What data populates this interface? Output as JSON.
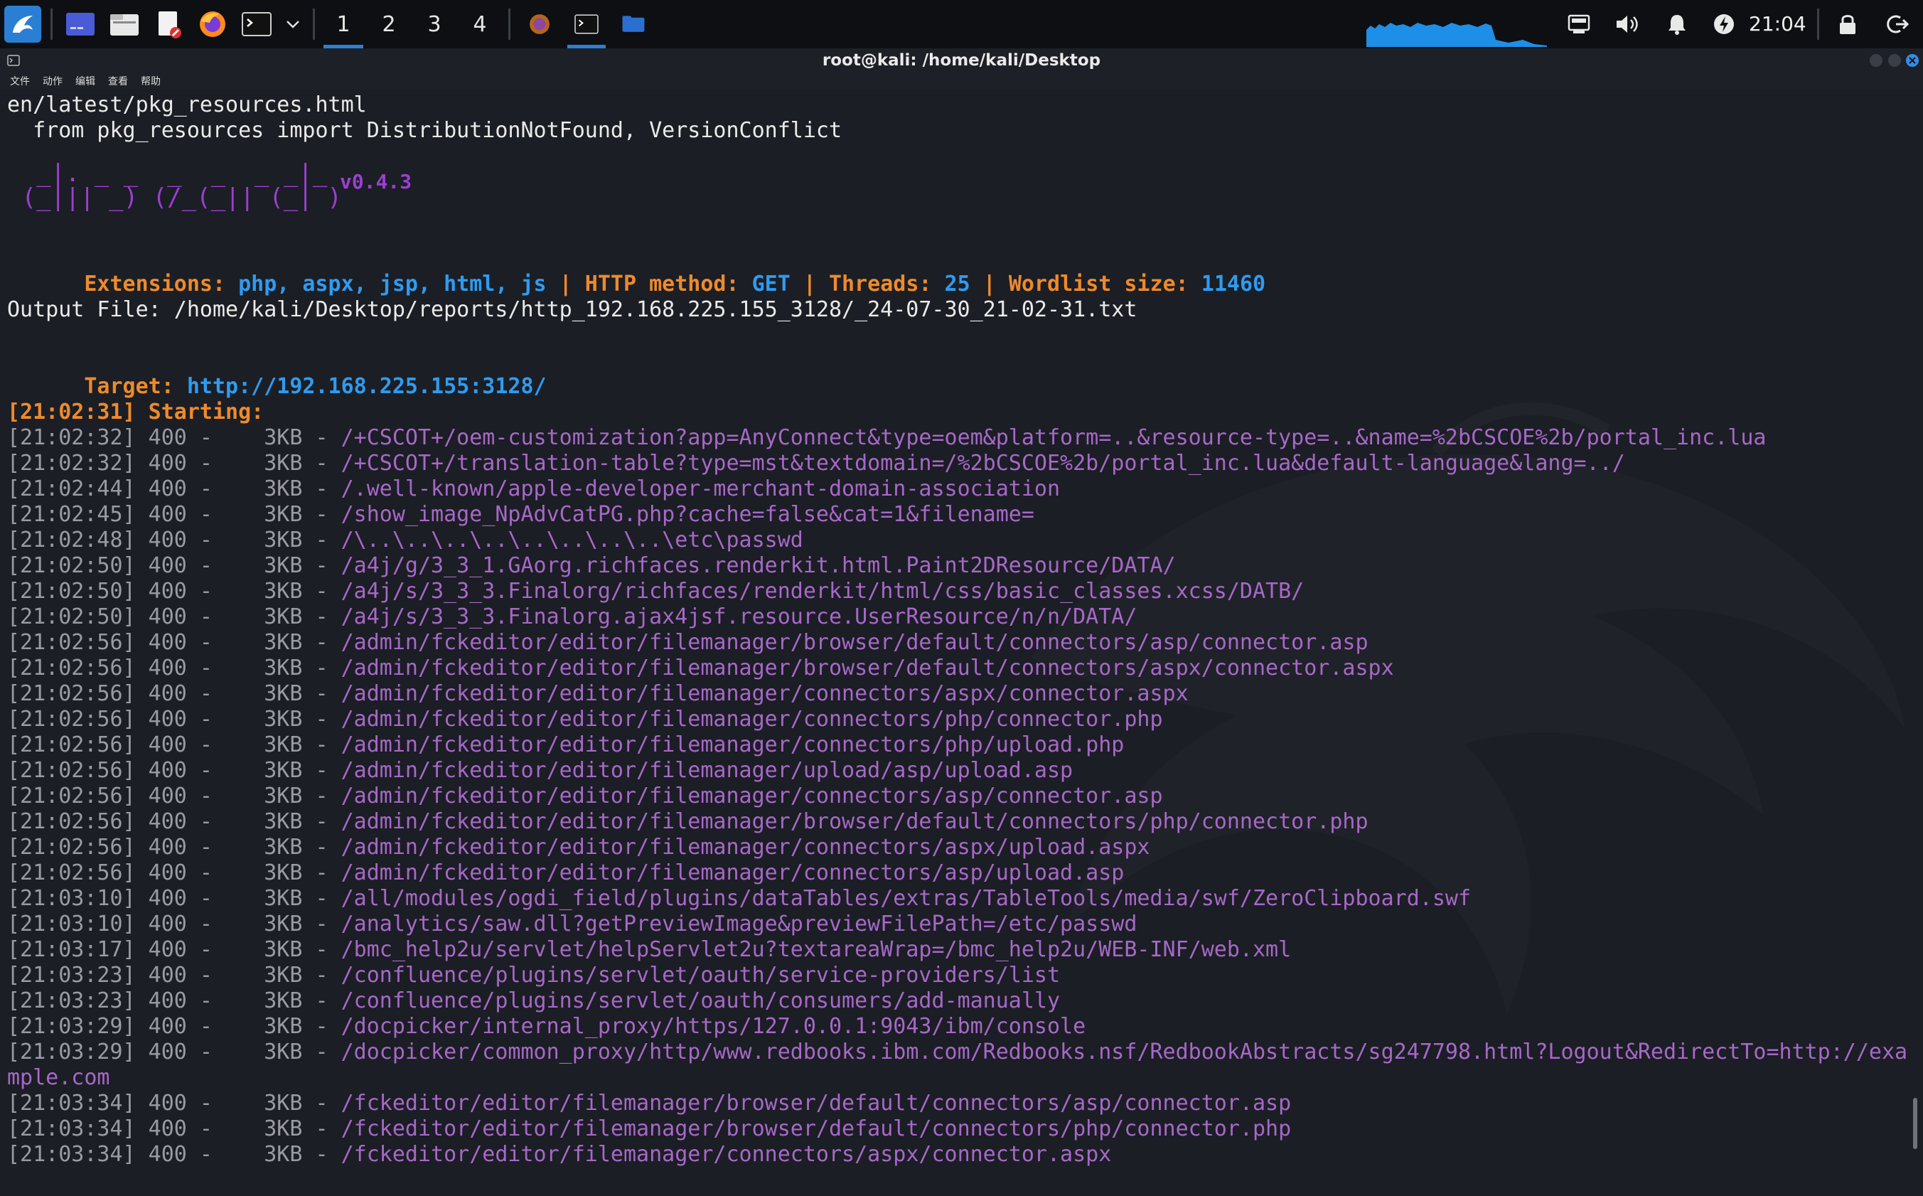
{
  "taskbar": {
    "workspaces": [
      "1",
      "2",
      "3",
      "4"
    ],
    "active_workspace": "1",
    "clock": "21:04",
    "icons": [
      "kali-menu-icon",
      "show-desktop-icon",
      "file-manager-icon",
      "text-editor-icon",
      "firefox-icon",
      "terminal-icon",
      "chevron-down-icon"
    ],
    "tray_icons": [
      "network-icon",
      "volume-icon",
      "notification-bell-icon",
      "power-manager-icon",
      "lock-icon",
      "logout-icon"
    ]
  },
  "window": {
    "title": "root@kali: /home/kali/Desktop",
    "menu": [
      "文件",
      "动作",
      "编辑",
      "查看",
      "帮助"
    ]
  },
  "terminal": {
    "pre_lines": [
      "en/latest/pkg_resources.html",
      "  from pkg_resources import DistributionNotFound, VersionConflict"
    ],
    "logo_line1": "  _|. _ _  _  _  _ _|_",
    "logo_line2": " (_||| _) (/_(_|| (_| )",
    "version": "v0.4.3",
    "config": {
      "ext_label": "Extensions:",
      "ext_value": "php, aspx, jsp, html, js",
      "method_label": "HTTP method:",
      "method_value": "GET",
      "threads_label": "Threads:",
      "threads_value": "25",
      "wordlist_label": "Wordlist size:",
      "wordlist_value": "11460",
      "sep": " | "
    },
    "output_file": "Output File: /home/kali/Desktop/reports/http_192.168.225.155_3128/_24-07-30_21-02-31.txt",
    "target_label": "Target:",
    "target_url": "http://192.168.225.155:3128/",
    "starting": "[21:02:31] Starting:",
    "results": [
      {
        "meta": "[21:02:32] 400 -    3KB - ",
        "path": "/+CSCOT+/oem-customization?app=AnyConnect&type=oem&platform=..&resource-type=..&name=%2bCSCOE%2b/portal_inc.lua"
      },
      {
        "meta": "[21:02:32] 400 -    3KB - ",
        "path": "/+CSCOT+/translation-table?type=mst&textdomain=/%2bCSCOE%2b/portal_inc.lua&default-language&lang=../"
      },
      {
        "meta": "[21:02:44] 400 -    3KB - ",
        "path": "/.well-known/apple-developer-merchant-domain-association"
      },
      {
        "meta": "[21:02:45] 400 -    3KB - ",
        "path": "/show_image_NpAdvCatPG.php?cache=false&cat=1&filename="
      },
      {
        "meta": "[21:02:48] 400 -    3KB - ",
        "path": "/\\..\\..\\..\\..\\..\\..\\..\\..\\etc\\passwd"
      },
      {
        "meta": "[21:02:50] 400 -    3KB - ",
        "path": "/a4j/g/3_3_1.GAorg.richfaces.renderkit.html.Paint2DResource/DATA/"
      },
      {
        "meta": "[21:02:50] 400 -    3KB - ",
        "path": "/a4j/s/3_3_3.Finalorg/richfaces/renderkit/html/css/basic_classes.xcss/DATB/"
      },
      {
        "meta": "[21:02:50] 400 -    3KB - ",
        "path": "/a4j/s/3_3_3.Finalorg.ajax4jsf.resource.UserResource/n/n/DATA/"
      },
      {
        "meta": "[21:02:56] 400 -    3KB - ",
        "path": "/admin/fckeditor/editor/filemanager/browser/default/connectors/asp/connector.asp"
      },
      {
        "meta": "[21:02:56] 400 -    3KB - ",
        "path": "/admin/fckeditor/editor/filemanager/browser/default/connectors/aspx/connector.aspx"
      },
      {
        "meta": "[21:02:56] 400 -    3KB - ",
        "path": "/admin/fckeditor/editor/filemanager/connectors/aspx/connector.aspx"
      },
      {
        "meta": "[21:02:56] 400 -    3KB - ",
        "path": "/admin/fckeditor/editor/filemanager/connectors/php/connector.php"
      },
      {
        "meta": "[21:02:56] 400 -    3KB - ",
        "path": "/admin/fckeditor/editor/filemanager/connectors/php/upload.php"
      },
      {
        "meta": "[21:02:56] 400 -    3KB - ",
        "path": "/admin/fckeditor/editor/filemanager/upload/asp/upload.asp"
      },
      {
        "meta": "[21:02:56] 400 -    3KB - ",
        "path": "/admin/fckeditor/editor/filemanager/connectors/asp/connector.asp"
      },
      {
        "meta": "[21:02:56] 400 -    3KB - ",
        "path": "/admin/fckeditor/editor/filemanager/browser/default/connectors/php/connector.php"
      },
      {
        "meta": "[21:02:56] 400 -    3KB - ",
        "path": "/admin/fckeditor/editor/filemanager/connectors/aspx/upload.aspx"
      },
      {
        "meta": "[21:02:56] 400 -    3KB - ",
        "path": "/admin/fckeditor/editor/filemanager/connectors/asp/upload.asp"
      },
      {
        "meta": "[21:03:10] 400 -    3KB - ",
        "path": "/all/modules/ogdi_field/plugins/dataTables/extras/TableTools/media/swf/ZeroClipboard.swf"
      },
      {
        "meta": "[21:03:10] 400 -    3KB - ",
        "path": "/analytics/saw.dll?getPreviewImage&previewFilePath=/etc/passwd"
      },
      {
        "meta": "[21:03:17] 400 -    3KB - ",
        "path": "/bmc_help2u/servlet/helpServlet2u?textareaWrap=/bmc_help2u/WEB-INF/web.xml"
      },
      {
        "meta": "[21:03:23] 400 -    3KB - ",
        "path": "/confluence/plugins/servlet/oauth/service-providers/list"
      },
      {
        "meta": "[21:03:23] 400 -    3KB - ",
        "path": "/confluence/plugins/servlet/oauth/consumers/add-manually"
      },
      {
        "meta": "[21:03:29] 400 -    3KB - ",
        "path": "/docpicker/internal_proxy/https/127.0.0.1:9043/ibm/console"
      },
      {
        "meta": "[21:03:29] 400 -    3KB - ",
        "path": "/docpicker/common_proxy/http/www.redbooks.ibm.com/Redbooks.nsf/RedbookAbstracts/sg247798.html?Logout&RedirectTo=http://exa"
      },
      {
        "meta": "",
        "path": "mple.com"
      },
      {
        "meta": "[21:03:34] 400 -    3KB - ",
        "path": "/fckeditor/editor/filemanager/browser/default/connectors/asp/connector.asp"
      },
      {
        "meta": "[21:03:34] 400 -    3KB - ",
        "path": "/fckeditor/editor/filemanager/browser/default/connectors/php/connector.php"
      },
      {
        "meta": "[21:03:34] 400 -    3KB - ",
        "path": "/fckeditor/editor/filemanager/connectors/aspx/connector.aspx"
      }
    ]
  }
}
